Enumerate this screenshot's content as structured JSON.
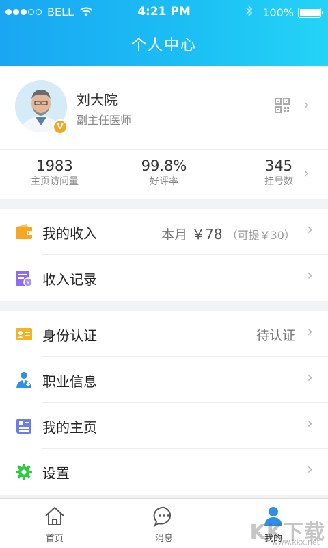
{
  "status_bar": {
    "carrier": "BELL",
    "time": "4:21 PM",
    "battery": "100%",
    "signal_bars": 3,
    "signal_total": 5
  },
  "header": {
    "title": "个人中心"
  },
  "profile": {
    "name": "刘大院",
    "title": "副主任医师",
    "verified_badge": "V",
    "qr_icon": "qr-code-icon"
  },
  "stats": [
    {
      "value": "1983",
      "label": "主页访问量"
    },
    {
      "value": "99.8%",
      "label": "好评率"
    },
    {
      "value": "345",
      "label": "挂号数"
    }
  ],
  "income_group": {
    "my_income": {
      "label": "我的收入",
      "value_prefix": "本月",
      "value_amount": "￥78",
      "value_sub": "（可提￥30）",
      "icon": "wallet-icon"
    },
    "income_records": {
      "label": "收入记录",
      "icon": "record-icon"
    }
  },
  "account_group": {
    "identity": {
      "label": "身份认证",
      "value": "待认证",
      "icon": "id-card-icon"
    },
    "career": {
      "label": "职业信息",
      "icon": "doctor-icon"
    },
    "homepage": {
      "label": "我的主页",
      "icon": "homepage-icon"
    },
    "settings": {
      "label": "设置",
      "icon": "gear-icon"
    }
  },
  "tabbar": {
    "home": "首页",
    "messages": "消息",
    "me": "我的",
    "active": "me"
  },
  "watermark": {
    "text": "KK下载",
    "url": "www.kkx.net"
  },
  "colors": {
    "header_start": "#1aa6f2",
    "header_end": "#24d3f6",
    "wallet": "#f5a623",
    "record": "#8c6cf0",
    "id_card": "#f5b222",
    "doctor": "#2f8fe8",
    "homepage": "#6a7cf0",
    "settings": "#2ecc40",
    "tab_active": "#2f8fe8"
  }
}
